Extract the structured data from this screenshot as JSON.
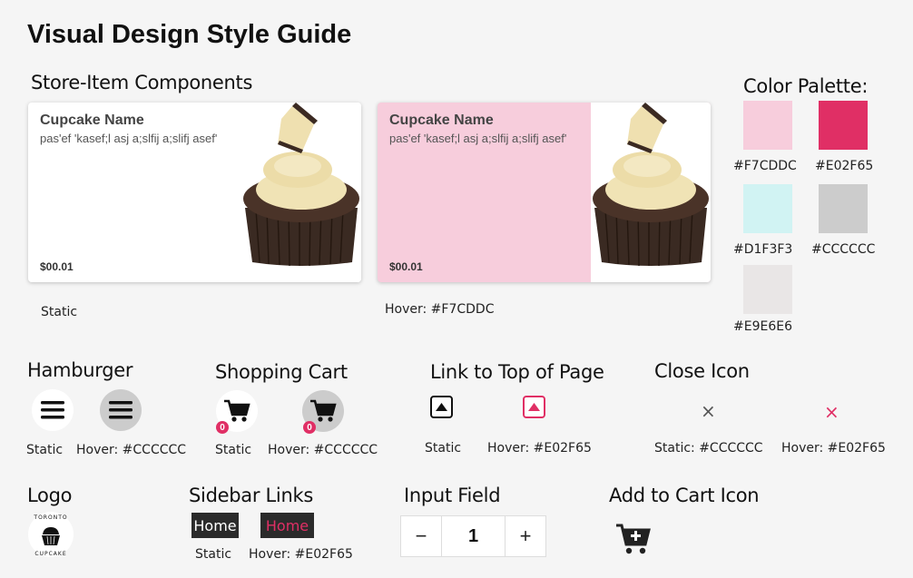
{
  "page_title": "Visual Design Style Guide",
  "store_item": {
    "heading": "Store-Item Components",
    "card": {
      "name": "Cupcake Name",
      "description": "pas'ef 'kasef;l asj a;slfij a;slifj asef'",
      "price": "$00.01"
    },
    "static_caption": "Static",
    "hover_caption": "Hover: #F7CDDC"
  },
  "palette": {
    "heading": "Color Palette:",
    "colors": [
      {
        "hex": "#F7CDDC",
        "label": "#F7CDDC"
      },
      {
        "hex": "#E02F65",
        "label": "#E02F65"
      },
      {
        "hex": "#D1F3F3",
        "label": "#D1F3F3"
      },
      {
        "hex": "#CCCCCC",
        "label": "#CCCCCC"
      },
      {
        "hex": "#E9E6E6",
        "label": "#E9E6E6"
      }
    ]
  },
  "hamburger": {
    "heading": "Hamburger",
    "static": "Static",
    "hover": "Hover: #CCCCCC"
  },
  "cart": {
    "heading": "Shopping Cart",
    "badge": "0",
    "static": "Static",
    "hover": "Hover: #CCCCCC"
  },
  "top_link": {
    "heading": "Link to Top of Page",
    "static": "Static",
    "hover": "Hover: #E02F65"
  },
  "close_icon": {
    "heading": "Close Icon",
    "glyph": "×",
    "static": "Static: #CCCCCC",
    "hover": "Hover: #E02F65"
  },
  "logo": {
    "heading": "Logo",
    "text_top": "TORONTO",
    "text_bottom": "CUPCAKE"
  },
  "sidebar_links": {
    "heading": "Sidebar Links",
    "label": "Home",
    "static": "Static",
    "hover": "Hover: #E02F65"
  },
  "input_field": {
    "heading": "Input Field",
    "minus": "−",
    "value": "1",
    "plus": "+"
  },
  "add_to_cart": {
    "heading": "Add to Cart Icon"
  },
  "colors": {
    "accent": "#E02F65",
    "pink": "#F7CDDC",
    "grey": "#CCCCCC"
  }
}
